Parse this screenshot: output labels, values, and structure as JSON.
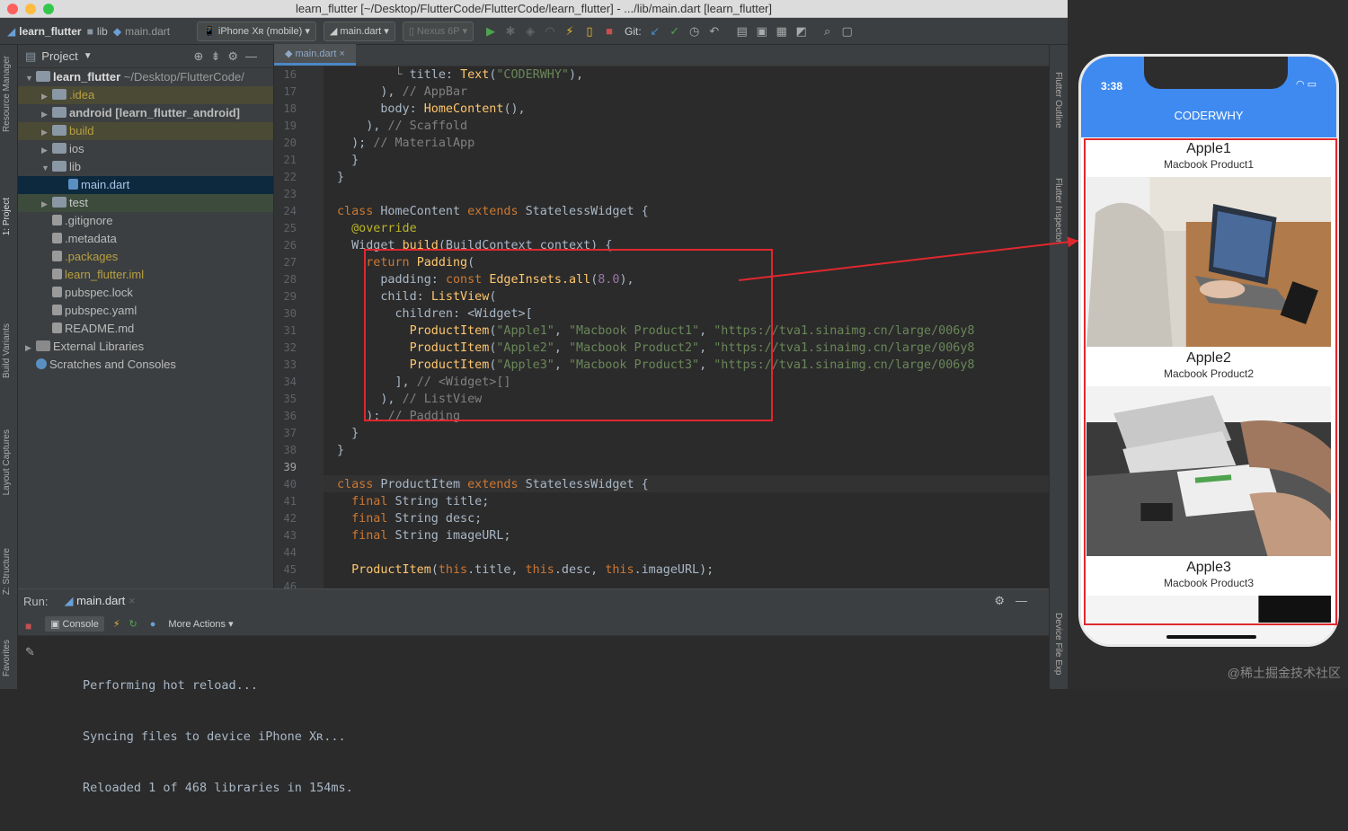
{
  "window_title": "learn_flutter [~/Desktop/FlutterCode/FlutterCode/learn_flutter] - .../lib/main.dart [learn_flutter]",
  "toolbar": {
    "breadcrumbs": [
      "learn_flutter",
      "lib",
      "main.dart"
    ],
    "device_combo": "iPhone Xʀ (mobile)",
    "run_config": "main.dart",
    "emulator_combo": "Nexus 6P",
    "git_label": "Git:"
  },
  "left_strip": {
    "labels": [
      "Resource Manager",
      "1: Project",
      "Build Variants",
      "Layout Captures",
      "Z: Structure",
      "Favorites"
    ]
  },
  "project": {
    "header": "Project",
    "tree": [
      {
        "label": ".idea",
        "level": 1,
        "arrow": "▶",
        "kind": "folder",
        "style": "ignored"
      },
      {
        "label": "android [learn_flutter_android]",
        "level": 1,
        "arrow": "▶",
        "kind": "folder",
        "style": "normal"
      },
      {
        "label": "build",
        "level": 1,
        "arrow": "▶",
        "kind": "folder",
        "style": "ignored"
      },
      {
        "label": "ios",
        "level": 1,
        "arrow": "▶",
        "kind": "folder",
        "style": "normal"
      },
      {
        "label": "lib",
        "level": 1,
        "arrow": "▼",
        "kind": "folder",
        "style": "normal"
      },
      {
        "label": "main.dart",
        "level": 2,
        "arrow": "",
        "kind": "file",
        "style": "selected"
      },
      {
        "label": "test",
        "level": 1,
        "arrow": "▶",
        "kind": "folder",
        "style": "test"
      },
      {
        "label": ".gitignore",
        "level": 1,
        "arrow": "",
        "kind": "file",
        "style": "normal"
      },
      {
        "label": ".metadata",
        "level": 1,
        "arrow": "",
        "kind": "file",
        "style": "normal"
      },
      {
        "label": ".packages",
        "level": 1,
        "arrow": "",
        "kind": "file",
        "style": "ignored"
      },
      {
        "label": "learn_flutter.iml",
        "level": 1,
        "arrow": "",
        "kind": "file",
        "style": "ignored"
      },
      {
        "label": "pubspec.lock",
        "level": 1,
        "arrow": "",
        "kind": "file",
        "style": "normal"
      },
      {
        "label": "pubspec.yaml",
        "level": 1,
        "arrow": "",
        "kind": "file",
        "style": "normal"
      },
      {
        "label": "README.md",
        "level": 1,
        "arrow": "",
        "kind": "file",
        "style": "normal"
      },
      {
        "label": "External Libraries",
        "level": 0,
        "arrow": "▶",
        "kind": "lib",
        "style": "normal"
      },
      {
        "label": "Scratches and Consoles",
        "level": 0,
        "arrow": "",
        "kind": "scratch",
        "style": "normal"
      }
    ],
    "root": "learn_flutter",
    "root_path": "~/Desktop/FlutterCode/"
  },
  "editor": {
    "tab": "main.dart",
    "lines": [
      {
        "n": "16",
        "html": "        <span class='cm'>└</span> title: <span class='fn'>Text</span>(<span class='st'>\"CODERWHY\"</span>),"
      },
      {
        "n": "17",
        "html": "      ), <span class='cm'>// AppBar</span>"
      },
      {
        "n": "18",
        "html": "      body: <span class='fn'>HomeContent</span>(),"
      },
      {
        "n": "19",
        "html": "    ), <span class='cm'>// Scaffold</span>"
      },
      {
        "n": "20",
        "html": "  ); <span class='cm'>// MaterialApp</span>"
      },
      {
        "n": "21",
        "html": "  }"
      },
      {
        "n": "22",
        "html": "}"
      },
      {
        "n": "23",
        "html": ""
      },
      {
        "n": "24",
        "html": "<span class='kw'>class</span> HomeContent <span class='kw'>extends</span> StatelessWidget {"
      },
      {
        "n": "25",
        "html": "  <span class='an'>@override</span>"
      },
      {
        "n": "26",
        "html": "  Widget <span class='fn'>build</span>(BuildContext context) {"
      },
      {
        "n": "27",
        "html": "    <span class='kw'>return</span> <span class='fn'>Padding</span>("
      },
      {
        "n": "28",
        "html": "      padding: <span class='kw'>const</span> <span class='fn'>EdgeInsets.all</span>(<span class='pu'>8.0</span>),"
      },
      {
        "n": "29",
        "html": "      child: <span class='fn'>ListView</span>("
      },
      {
        "n": "30",
        "html": "        children: &lt;Widget&gt;["
      },
      {
        "n": "31",
        "html": "          <span class='fn'>ProductItem</span>(<span class='st'>\"Apple1\"</span>, <span class='st'>\"Macbook Product1\"</span>, <span class='st'>\"https://tva1.sinaimg.cn/large/006y8</span>"
      },
      {
        "n": "32",
        "html": "          <span class='fn'>ProductItem</span>(<span class='st'>\"Apple2\"</span>, <span class='st'>\"Macbook Product2\"</span>, <span class='st'>\"https://tva1.sinaimg.cn/large/006y8</span>"
      },
      {
        "n": "33",
        "html": "          <span class='fn'>ProductItem</span>(<span class='st'>\"Apple3\"</span>, <span class='st'>\"Macbook Product3\"</span>, <span class='st'>\"https://tva1.sinaimg.cn/large/006y8</span>"
      },
      {
        "n": "34",
        "html": "        ], <span class='cm'>// &lt;Widget&gt;[]</span>"
      },
      {
        "n": "35",
        "html": "      ), <span class='cm'>// ListView</span>"
      },
      {
        "n": "36",
        "html": "    ); <span class='cm'>// Padding</span>"
      },
      {
        "n": "37",
        "html": "  }"
      },
      {
        "n": "38",
        "html": "}"
      },
      {
        "n": "39",
        "html": ""
      },
      {
        "n": "40",
        "html": "<span class='kw'>class</span> ProductItem <span class='kw'>extends</span> StatelessWidget {"
      },
      {
        "n": "41",
        "html": "  <span class='kw'>final</span> String title;"
      },
      {
        "n": "42",
        "html": "  <span class='kw'>final</span> String desc;"
      },
      {
        "n": "43",
        "html": "  <span class='kw'>final</span> String imageURL;"
      },
      {
        "n": "44",
        "html": ""
      },
      {
        "n": "45",
        "html": "  <span class='fn'>ProductItem</span>(<span class='kw'>this</span>.title, <span class='kw'>this</span>.desc, <span class='kw'>this</span>.imageURL);"
      },
      {
        "n": "46",
        "html": ""
      }
    ]
  },
  "right_strip": {
    "labels": [
      "Flutter Outline",
      "Flutter Inspector",
      "Device File Exp"
    ]
  },
  "run": {
    "label": "Run:",
    "tab": "main.dart",
    "console_tab": "Console",
    "more_actions": "More Actions",
    "console_lines": [
      "Performing hot reload...",
      "Syncing files to device iPhone Xʀ...",
      "Reloaded 1 of 468 libraries in 154ms."
    ]
  },
  "phone": {
    "time": "3:38",
    "app_title": "CODERWHY",
    "items": [
      {
        "title": "Apple1",
        "desc": "Macbook Product1"
      },
      {
        "title": "Apple2",
        "desc": "Macbook Product2"
      },
      {
        "title": "Apple3",
        "desc": "Macbook Product3"
      }
    ]
  },
  "watermark": "@稀土掘金技术社区",
  "colors": {
    "accent": "#3f8af0",
    "annotation": "#e0282e"
  }
}
